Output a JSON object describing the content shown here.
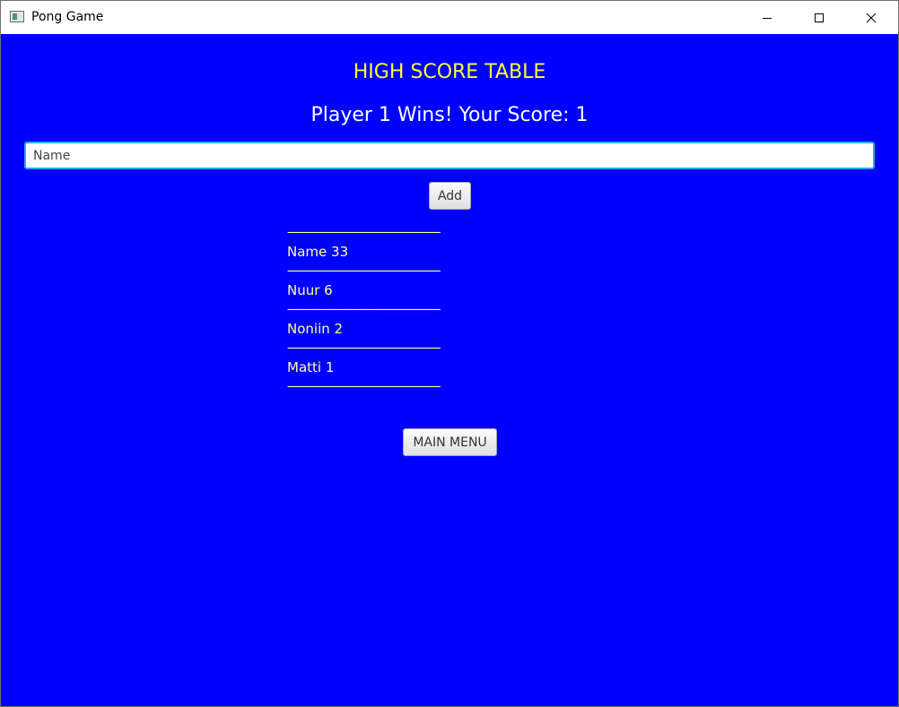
{
  "window": {
    "title": "Pong Game"
  },
  "screen": {
    "heading": "HIGH SCORE TABLE",
    "result_message": "Player 1 Wins! Your Score: 1",
    "name_input": {
      "placeholder": "Name",
      "value": ""
    },
    "add_button_label": "Add",
    "separator": "-------------------------------------------------------",
    "scores": [
      {
        "text": "Name 33"
      },
      {
        "text": "Nuur 6"
      },
      {
        "text": "Noniin 2"
      },
      {
        "text": "Matti 1"
      }
    ],
    "main_menu_button_label": "MAIN MENU"
  },
  "colors": {
    "background": "#0000ff",
    "heading": "#ffff33",
    "score_text": "#ffff99",
    "message": "#ffffff",
    "input_focus_border": "#29a9e9"
  },
  "icons": {
    "app": "app-window-icon",
    "minimize": "minimize-icon",
    "maximize": "maximize-icon",
    "close": "close-icon"
  }
}
